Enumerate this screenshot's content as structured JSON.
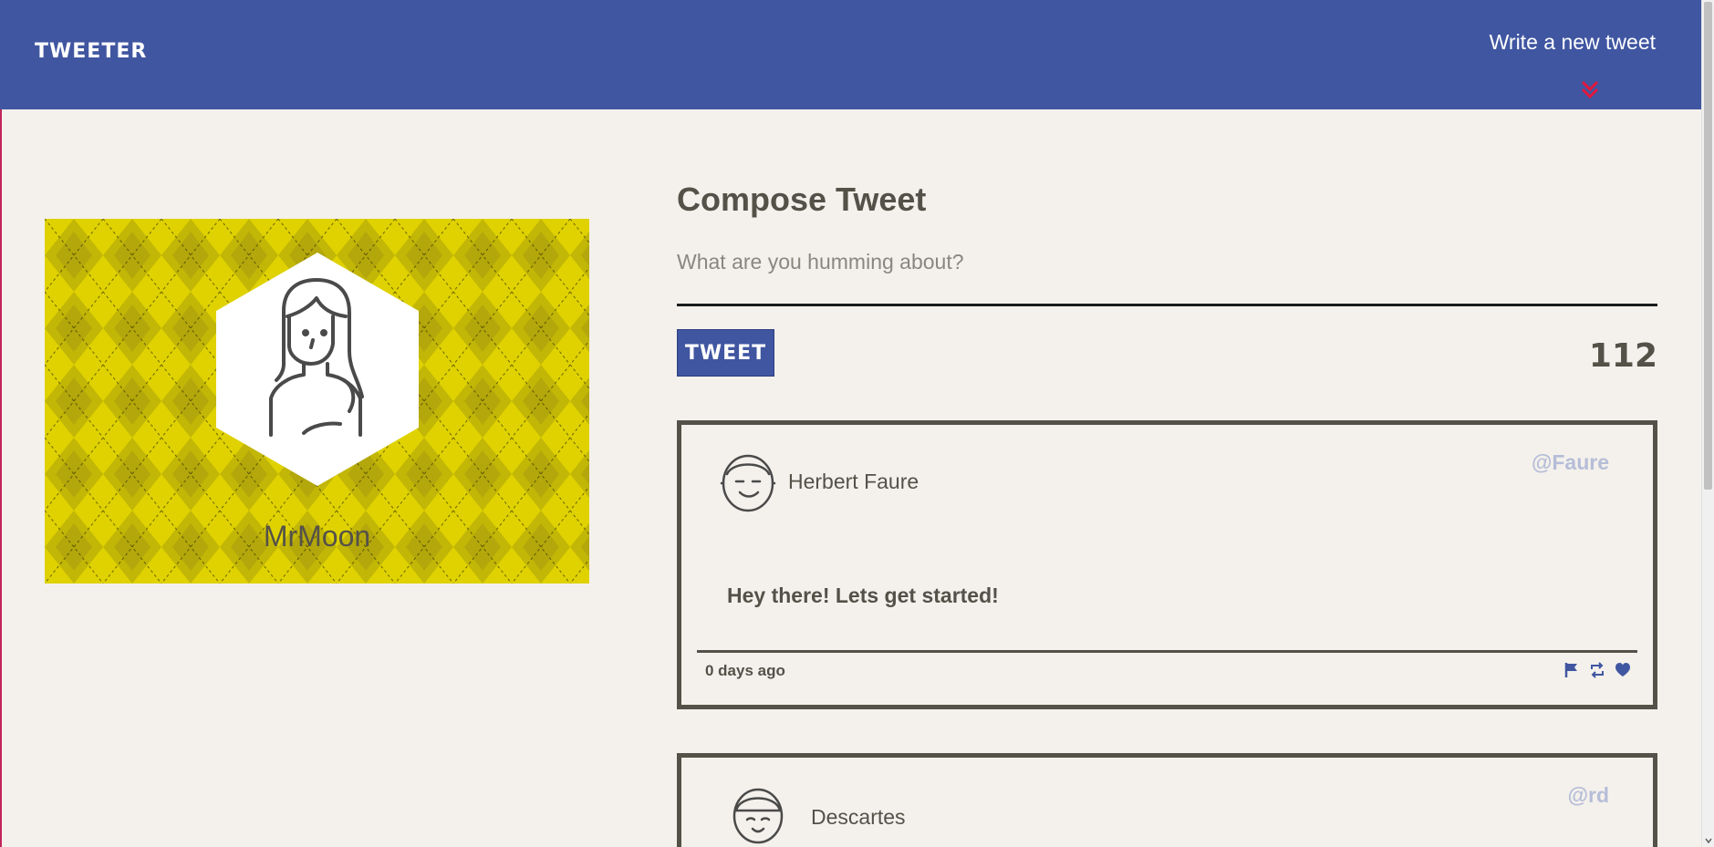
{
  "nav": {
    "brand": "TWEETER",
    "compose_link": "Write a new tweet",
    "icons": {
      "chevron": "double-chevron-down-icon"
    },
    "colors": {
      "background": "#4056a1",
      "chevron": "#e3173c"
    }
  },
  "profile": {
    "name": "MrMoon",
    "colors": {
      "argyle_light": "#dfd200",
      "argyle_dark": "#a89b0e"
    }
  },
  "compose": {
    "title": "Compose Tweet",
    "placeholder": "What are you humming about?",
    "button_label": "TWEET",
    "counter": "112"
  },
  "tweets": [
    {
      "name": "Herbert Faure",
      "handle": "@Faure",
      "text": "Hey there! Lets get started!",
      "date": "0 days ago",
      "actions": [
        "flag-icon",
        "retweet-icon",
        "heart-icon"
      ]
    },
    {
      "name": "Descartes",
      "handle": "@rd"
    }
  ]
}
